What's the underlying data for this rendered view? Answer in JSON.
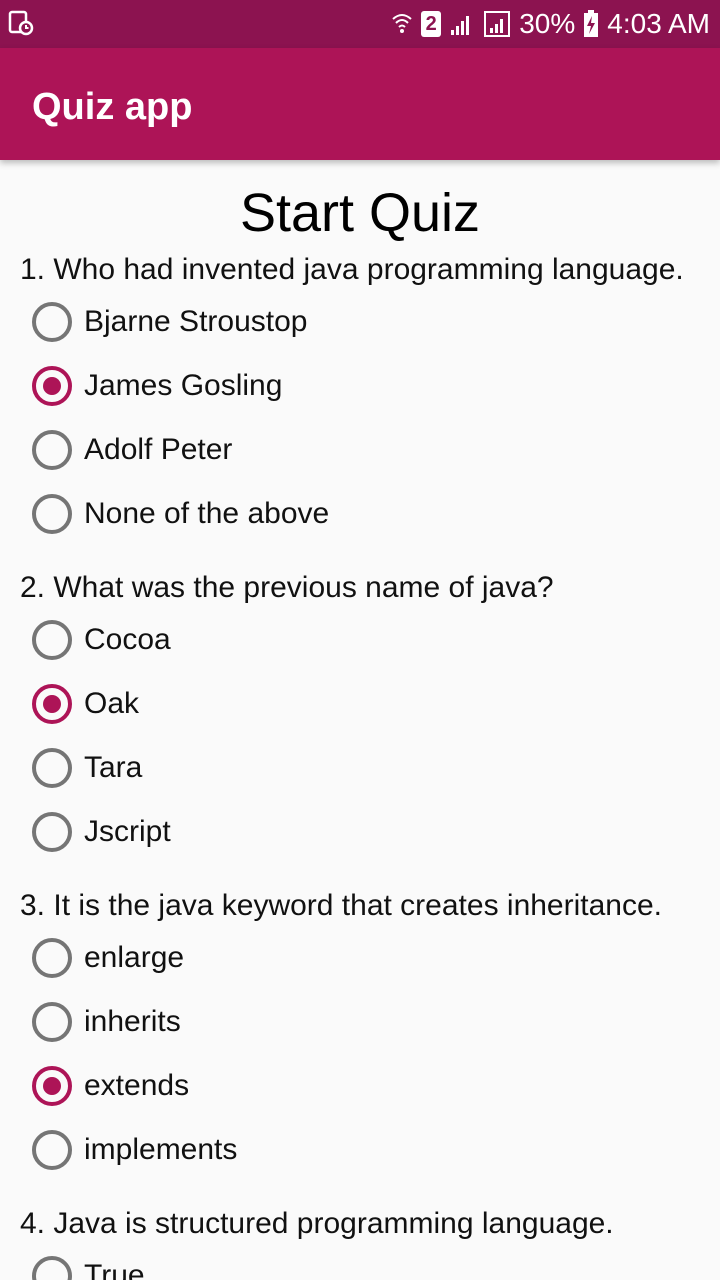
{
  "status_bar": {
    "battery": "30%",
    "time": "4:03 AM",
    "sim_badge": "2",
    "colors": {
      "background": "#8c1350",
      "text": "#ffffff"
    }
  },
  "app_bar": {
    "title": "Quiz app",
    "colors": {
      "background": "#ad1457",
      "text": "#ffffff"
    }
  },
  "main": {
    "page_title": "Start Quiz",
    "questions": [
      {
        "text": "1. Who had invented java programming language.",
        "options": [
          "Bjarne Stroustop",
          "James Gosling",
          "Adolf Peter",
          "None of the above"
        ],
        "selected": "James Gosling"
      },
      {
        "text": "2. What was the previous name of java?",
        "options": [
          "Cocoa",
          "Oak",
          "Tara",
          "Jscript"
        ],
        "selected": "Oak"
      },
      {
        "text": "3. It is the java keyword that creates inheritance.",
        "options": [
          "enlarge",
          "inherits",
          "extends",
          "implements"
        ],
        "selected": "extends"
      },
      {
        "text": "4. Java is structured programming language.",
        "options": [
          "True"
        ],
        "selected": ""
      }
    ],
    "accent_color": "#ad1457"
  }
}
